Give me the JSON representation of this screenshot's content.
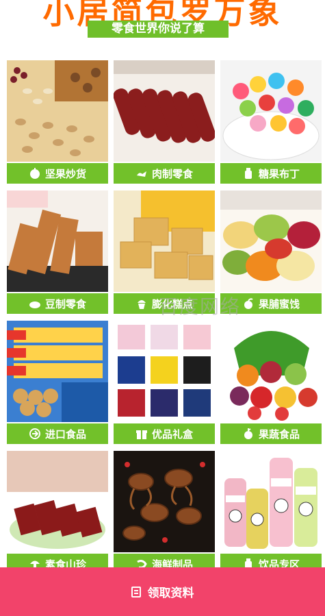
{
  "header": {
    "title": "小居简包罗万象",
    "subtitle": "零食世界你说了算"
  },
  "categories": [
    {
      "label": "坚果炒货",
      "icon": "nut-icon"
    },
    {
      "label": "肉制零食",
      "icon": "duck-icon"
    },
    {
      "label": "糖果布丁",
      "icon": "candy-icon"
    },
    {
      "label": "豆制零食",
      "icon": "tofu-icon"
    },
    {
      "label": "膨化糕点",
      "icon": "cupcake-icon"
    },
    {
      "label": "果脯蜜饯",
      "icon": "fruit-icon"
    },
    {
      "label": "进口食品",
      "icon": "import-icon"
    },
    {
      "label": "优品礼盒",
      "icon": "gift-icon"
    },
    {
      "label": "果蔬食品",
      "icon": "vegetable-icon"
    },
    {
      "label": "素食山珍",
      "icon": "mushroom-icon"
    },
    {
      "label": "海鲜制品",
      "icon": "shrimp-icon"
    },
    {
      "label": "饮品专区",
      "icon": "bottle-icon"
    }
  ],
  "watermark": "百度网络",
  "cta": {
    "label": "领取资料",
    "icon": "document-icon"
  },
  "colors": {
    "green": "#72c12a",
    "orange": "#ff6a00",
    "cta": "#f2436a"
  }
}
